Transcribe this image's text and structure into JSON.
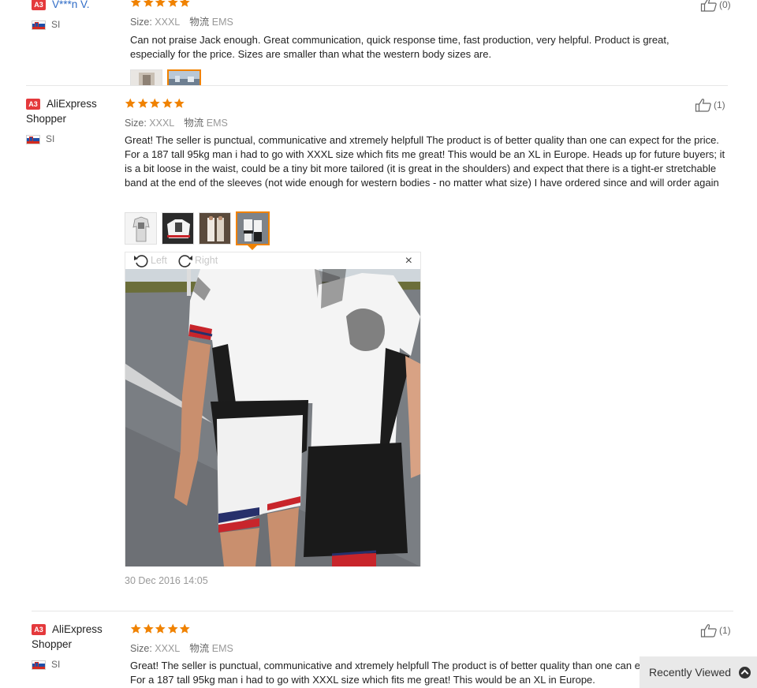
{
  "colors": {
    "star": "#f08200",
    "badge": "#e4393c",
    "accent": "#f08200"
  },
  "reviews": [
    {
      "badge": "A3",
      "name": "V***n V.",
      "country": "SI",
      "rating": 5,
      "size_label": "Size:",
      "size_value": "XXXL",
      "shipping_label": "物流",
      "shipping_value": "EMS",
      "text": "Can not praise Jack enough. Great communication, quick response time, fast production, very helpful. Product is great, especially for the price. Sizes are smaller than what the western body sizes are.",
      "likes": "(0)"
    },
    {
      "badge": "A3",
      "name": "AliExpress Shopper",
      "country": "SI",
      "rating": 5,
      "size_label": "Size:",
      "size_value": "XXXL",
      "shipping_label": "物流",
      "shipping_value": "EMS",
      "text": "Great! The seller is punctual, communicative and xtremely helpfull The product is of better quality than one can expect for the price. For a 187 tall 95kg man i had to go with XXXL size which fits me great! This would be an XL in Europe. Heads up for future buyers; it is a bit loose in the waist, could be a tiny bit more tailored (it is great in the shoulders) and expect that there is a tight-er stretchable band at the end of the sleeves (not wide enough for western bodies - no matter what size) I have ordered since and will order again",
      "likes": "(1)",
      "viewer": {
        "rotate_left": "Left",
        "rotate_right": "Right",
        "close": "×"
      },
      "date": "30 Dec 2016 14:05"
    },
    {
      "badge": "A3",
      "name": "AliExpress Shopper",
      "country": "SI",
      "rating": 5,
      "size_label": "Size:",
      "size_value": "XXXL",
      "shipping_label": "物流",
      "shipping_value": "EMS",
      "text": "Great! The seller is punctual, communicative and xtremely helpfull The product is of better quality than one can expect for the price. For a 187 tall 95kg man i had to go with XXXL size which fits me great! This would be an XL in Europe.",
      "likes": "(1)"
    }
  ],
  "recently_viewed": "Recently Viewed"
}
